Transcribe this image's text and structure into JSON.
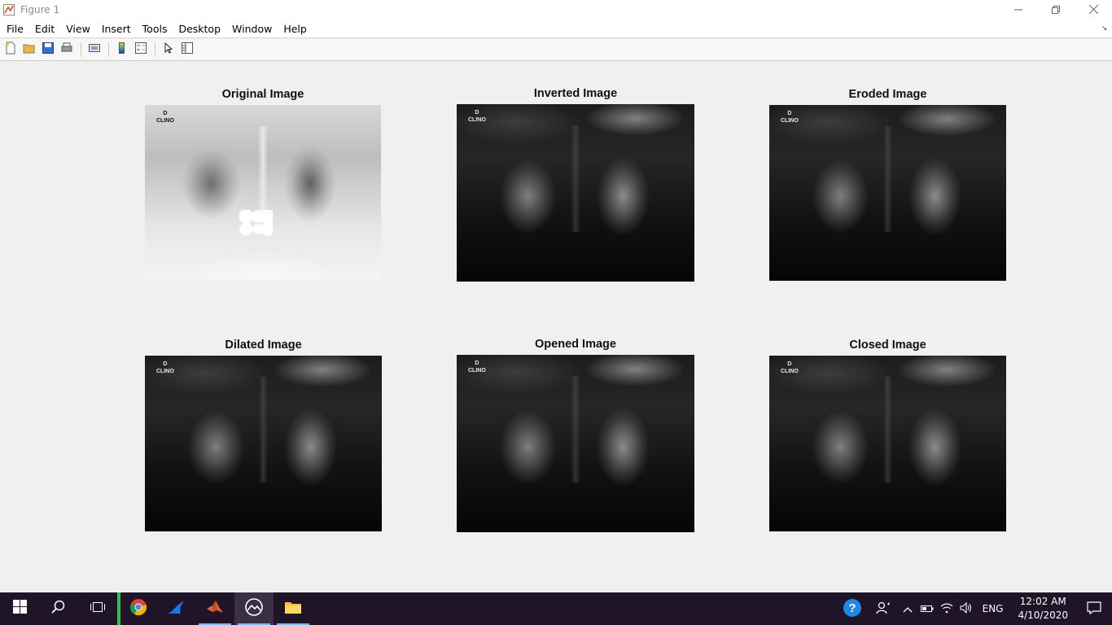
{
  "window": {
    "title": "Figure 1",
    "controls": [
      "minimize-icon",
      "restore-icon",
      "close-icon"
    ]
  },
  "menu": {
    "items": [
      "File",
      "Edit",
      "View",
      "Insert",
      "Tools",
      "Desktop",
      "Window",
      "Help"
    ]
  },
  "toolbar": {
    "buttons": [
      "new-figure-icon",
      "open-file-icon",
      "save-icon",
      "print-icon",
      "link-plot-icon",
      "insert-colorbar-icon",
      "insert-legend-icon",
      "edit-plot-icon",
      "property-inspector-icon"
    ]
  },
  "subplots": [
    {
      "title": "Original Image",
      "style": "light",
      "label_line1": "D",
      "label_line2": "CLINO"
    },
    {
      "title": "Inverted Image",
      "style": "dark",
      "label_line1": "D",
      "label_line2": "CLINO"
    },
    {
      "title": "Eroded Image",
      "style": "dark",
      "label_line1": "D",
      "label_line2": "CLINO"
    },
    {
      "title": "Dilated Image",
      "style": "dark",
      "label_line1": "D",
      "label_line2": "CLINO"
    },
    {
      "title": "Opened Image",
      "style": "dark",
      "label_line1": "D",
      "label_line2": "CLINO"
    },
    {
      "title": "Closed Image",
      "style": "dark",
      "label_line1": "D",
      "label_line2": "CLINO"
    }
  ],
  "taskbar": {
    "apps": [
      "windows-start-icon",
      "search-icon",
      "task-view-icon",
      "chrome-icon",
      "app-shark-icon",
      "matlab-icon",
      "image-viewer-icon",
      "file-explorer-icon"
    ],
    "tray": {
      "language": "ENG",
      "time": "12:02 AM",
      "date": "4/10/2020"
    }
  },
  "colors": {
    "taskbar": "#1f1428",
    "figure_bg": "#f0f0f0",
    "accent": "#76b9ed"
  }
}
